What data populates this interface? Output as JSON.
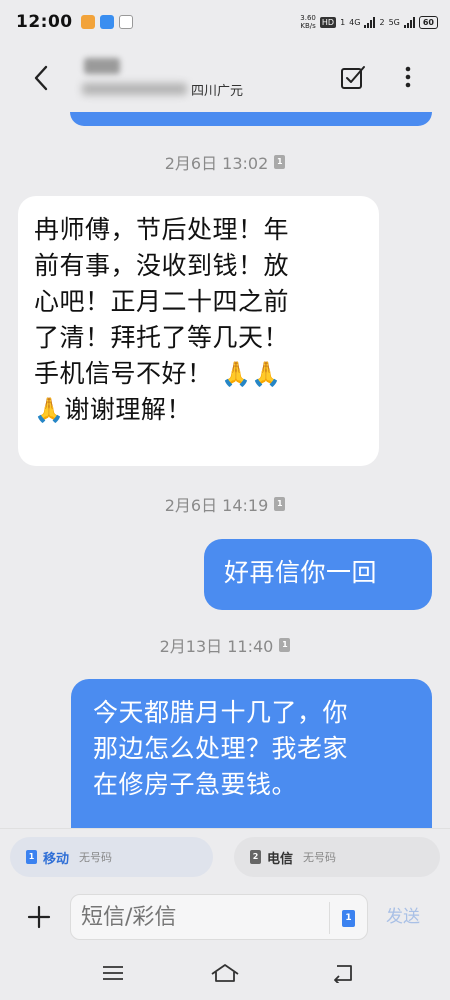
{
  "status_bar": {
    "time": "12:00",
    "net_speed_value": "3.60",
    "net_speed_unit": "KB/s",
    "hd_label": "HD",
    "sim1_num": "1",
    "sim2_num": "2",
    "network_4g": "4G",
    "network_5g": "5G",
    "battery": "60"
  },
  "header": {
    "location": "四川广元"
  },
  "messages": [
    {
      "type": "timestamp",
      "text": "2月6日 13:02",
      "sim": "1"
    },
    {
      "type": "incoming",
      "lines": [
        "冉师傅，节后处理！年",
        "前有事，没收到钱！放",
        "心吧！正月二十四之前",
        "了清！拜托了等几天！",
        "手机信号不好！",
        "谢谢理解！"
      ]
    },
    {
      "type": "timestamp",
      "text": "2月6日 14:19",
      "sim": "1"
    },
    {
      "type": "outgoing",
      "text": "好再信你一回"
    },
    {
      "type": "timestamp",
      "text": "2月13日 11:40",
      "sim": "1"
    },
    {
      "type": "outgoing",
      "lines": [
        "今天都腊月十几了，你",
        "那边怎么处理？我老家",
        "在修房子急要钱。"
      ]
    }
  ],
  "sim_selector": [
    {
      "num": "1",
      "name": "移动",
      "status": "无号码"
    },
    {
      "num": "2",
      "name": "电信",
      "status": "无号码"
    }
  ],
  "composer": {
    "placeholder": "短信/彩信",
    "sim_num": "1",
    "send_label": "发送"
  },
  "colors": {
    "outgoing_bubble": "#4b8cf0",
    "incoming_bubble": "#ffffff",
    "background": "#ececee"
  }
}
